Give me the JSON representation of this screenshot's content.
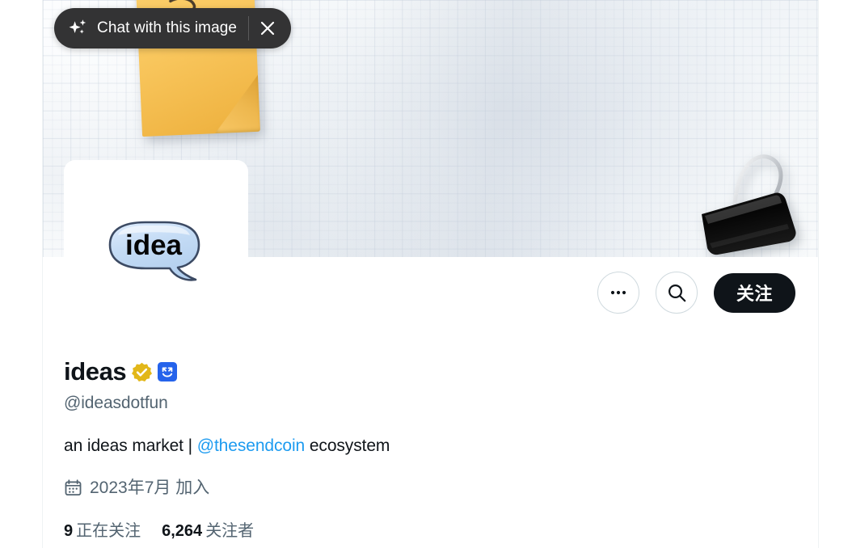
{
  "overlay": {
    "sparkle_icon": "sparkle-icon",
    "chat_label": "Chat with this image",
    "close_icon": "close-icon"
  },
  "banner": {
    "alt": "graph paper with yellow sticky note and black binder clip",
    "sticky_note_icon": "sticky-note",
    "binder_clip_icon": "binder-clip-icon",
    "grid_color": "#cbd4e0",
    "paper_color": "#f4f7f9",
    "sticky_note_color": "#f9c75e"
  },
  "avatar": {
    "name": "avatar-image",
    "bubble_text": "idea",
    "bubble_color": "#bcd8f2",
    "background": "#ffffff"
  },
  "actions": {
    "more_label": "•••",
    "more_icon": "more-horizontal-icon",
    "search_icon": "search-icon",
    "follow_label": "关注",
    "follow_bg": "#0f1419"
  },
  "profile": {
    "display_name": "ideas",
    "verified_badge_icon": "verified-badge-gold",
    "verified_badge_color": "#e2b719",
    "emoji_badge_icon": "blue-square-emoji-badge",
    "emoji_badge_color": "#2563eb",
    "handle": "@ideasdotfun",
    "bio_prefix": "an ideas market | ",
    "bio_mention": "@thesendcoin",
    "bio_suffix": " ecosystem",
    "mention_color": "#1d9bf0",
    "calendar_icon": "calendar-icon",
    "joined": "2023年7月 加入",
    "stats": [
      {
        "value": "9",
        "label": "正在关注"
      },
      {
        "value": "6,264",
        "label": "关注者"
      }
    ]
  }
}
